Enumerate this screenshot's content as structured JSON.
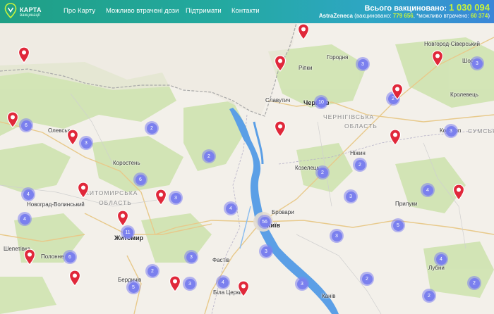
{
  "header": {
    "logo_title": "КАРТА",
    "logo_sub": "вакцинації",
    "nav": [
      "Про Карту",
      "Можливо втрачені дози",
      "Підтримати",
      "Контакти"
    ],
    "total_label": "Всього вакциновано:",
    "total_value": "1 030 094",
    "vaccine_name": "AstraZeneca",
    "vaccinated_label": "(вакциновано:",
    "vaccinated_value": "779 656",
    "lost_label": ", *можливо втрачено:",
    "lost_value": "60 374",
    "close_paren": ")"
  },
  "colors": {
    "header_start": "#1f9f85",
    "header_end": "#3a86d8",
    "accent": "#c8f33b",
    "cluster": "#7b80ee",
    "pin": "#e0283a",
    "water": "#4a90e2"
  },
  "cities": [
    {
      "id": "olevsk",
      "name": "Олевськ"
    },
    {
      "id": "korosten",
      "name": "Коростень"
    },
    {
      "id": "novograd",
      "name": "Новоград-Волинський"
    },
    {
      "id": "zhytomyr",
      "name": "Житомир"
    },
    {
      "id": "shepetivka",
      "name": "Шепетівка"
    },
    {
      "id": "polonne",
      "name": "Полонне"
    },
    {
      "id": "berdychiv",
      "name": "Бердичів"
    },
    {
      "id": "fastiv",
      "name": "Фастів"
    },
    {
      "id": "bila_tserkva",
      "name": "Біла Церква"
    },
    {
      "id": "kyiv",
      "name": "Київ"
    },
    {
      "id": "brovary",
      "name": "Бровари"
    },
    {
      "id": "kanev",
      "name": "Канів"
    },
    {
      "id": "slavutych",
      "name": "Славутич"
    },
    {
      "id": "chernihiv",
      "name": "Чернігів"
    },
    {
      "id": "horodnia",
      "name": "Городня"
    },
    {
      "id": "ripky",
      "name": "Ріпки"
    },
    {
      "id": "nizhyn",
      "name": "Ніжин"
    },
    {
      "id": "kozelets",
      "name": "Козелець"
    },
    {
      "id": "pryluky",
      "name": "Прилуки"
    },
    {
      "id": "lubny",
      "name": "Лубни"
    },
    {
      "id": "novgorod_siverskyi",
      "name": "Новгород-Сіверський"
    },
    {
      "id": "krolevets",
      "name": "Кролевець"
    },
    {
      "id": "konotop",
      "name": "Конотоп"
    },
    {
      "id": "shostka",
      "name": "Шостка"
    },
    {
      "id": "sumska",
      "name": "СУМСЬКА"
    }
  ],
  "regions": [
    {
      "id": "zhytomyrska",
      "name": "ЖИТОМИРСЬКА"
    },
    {
      "id": "oblast1",
      "name": "ОБЛАСТЬ"
    },
    {
      "id": "chernihivska",
      "name": "ЧЕРНІГІВСЬКА"
    },
    {
      "id": "oblast2",
      "name": "ОБЛАСТЬ"
    }
  ],
  "clusters": [
    "3",
    "6",
    "3",
    "2",
    "2",
    "6",
    "4",
    "3",
    "4",
    "3",
    "4",
    "11",
    "6",
    "3",
    "2",
    "5",
    "3",
    "4",
    "2",
    "56",
    "3",
    "3",
    "2",
    "3",
    "10",
    "3",
    "2",
    "2",
    "2",
    "3",
    "5",
    "3",
    "4",
    "4",
    "2",
    "3",
    "2",
    "3",
    "4",
    "2",
    "5",
    "3"
  ]
}
